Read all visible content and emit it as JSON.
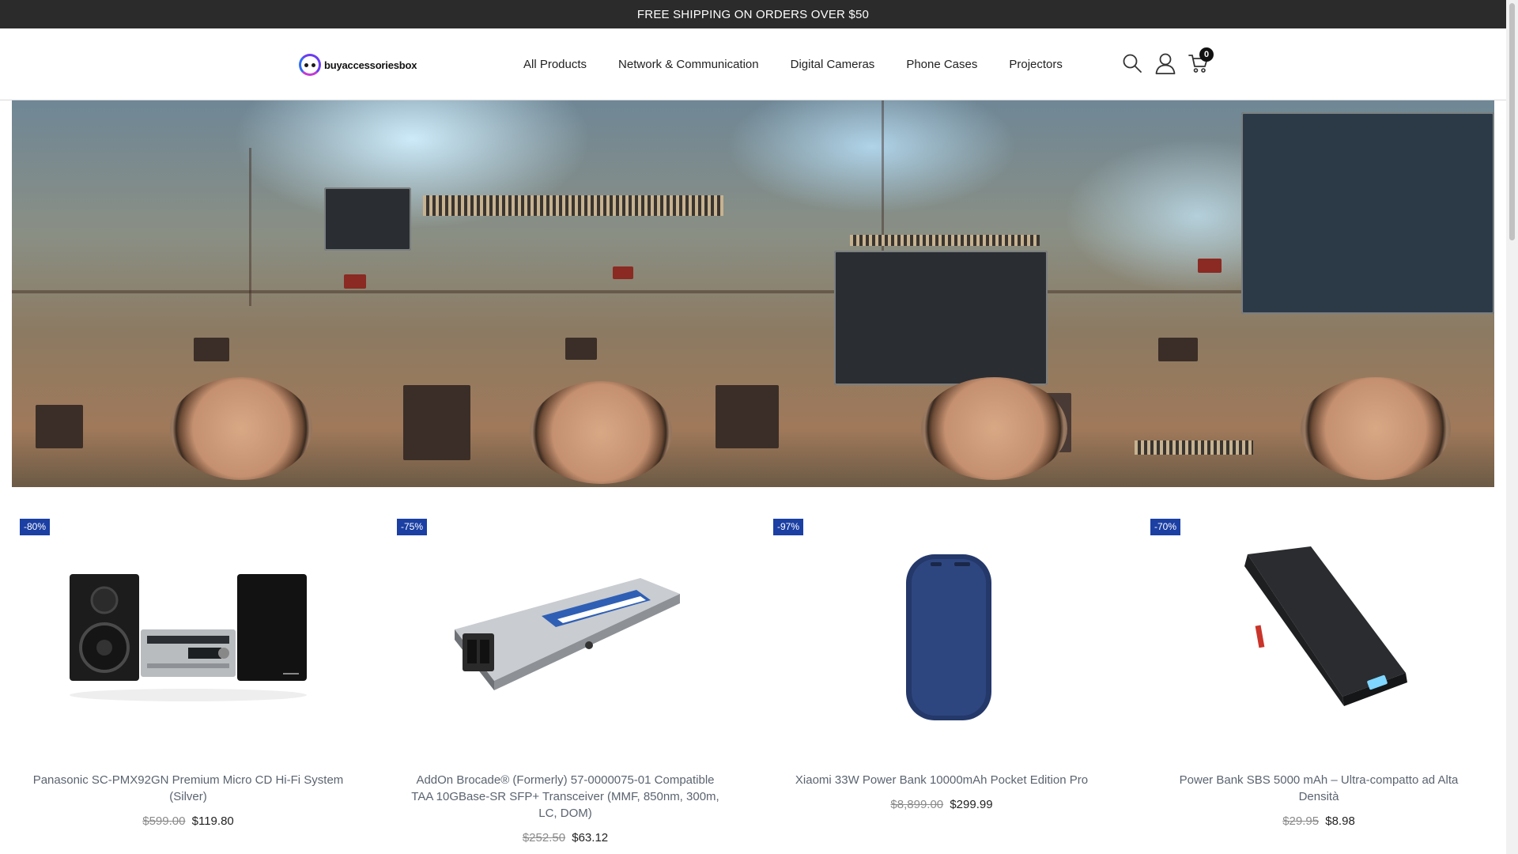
{
  "promo": {
    "text": "FREE SHIPPING ON ORDERS OVER $50"
  },
  "header": {
    "logo_text": "buyaccessoriesbox",
    "nav": [
      "All Products",
      "Network & Communication",
      "Digital Cameras",
      "Phone Cases",
      "Projectors"
    ],
    "icons": [
      "search-icon",
      "user-icon",
      "cart-icon"
    ],
    "cart_count": "0"
  },
  "colors": {
    "promo_bg": "#2b2b2b",
    "badge_bg": "#1b3fa3",
    "title_text": "#5b6470"
  },
  "products": [
    {
      "badge": "-80%",
      "title": "Panasonic SC-PMX92GN Premium Micro CD Hi-Fi System (Silver)",
      "old_price": "$599.00",
      "price": "$119.80"
    },
    {
      "badge": "-75%",
      "title": "AddOn Brocade® (Formerly) 57-0000075-01 Compatible TAA 10GBase-SR SFP+ Transceiver (MMF, 850nm, 300m, LC, DOM)",
      "old_price": "$252.50",
      "price": "$63.12"
    },
    {
      "badge": "-97%",
      "title": "Xiaomi 33W Power Bank 10000mAh Pocket Edition Pro",
      "old_price": "$8,899.00",
      "price": "$299.99"
    },
    {
      "badge": "-70%",
      "title": "Power Bank SBS 5000 mAh – Ultra-compatto ad Alta Densità",
      "old_price": "$29.95",
      "price": "$8.98"
    }
  ]
}
